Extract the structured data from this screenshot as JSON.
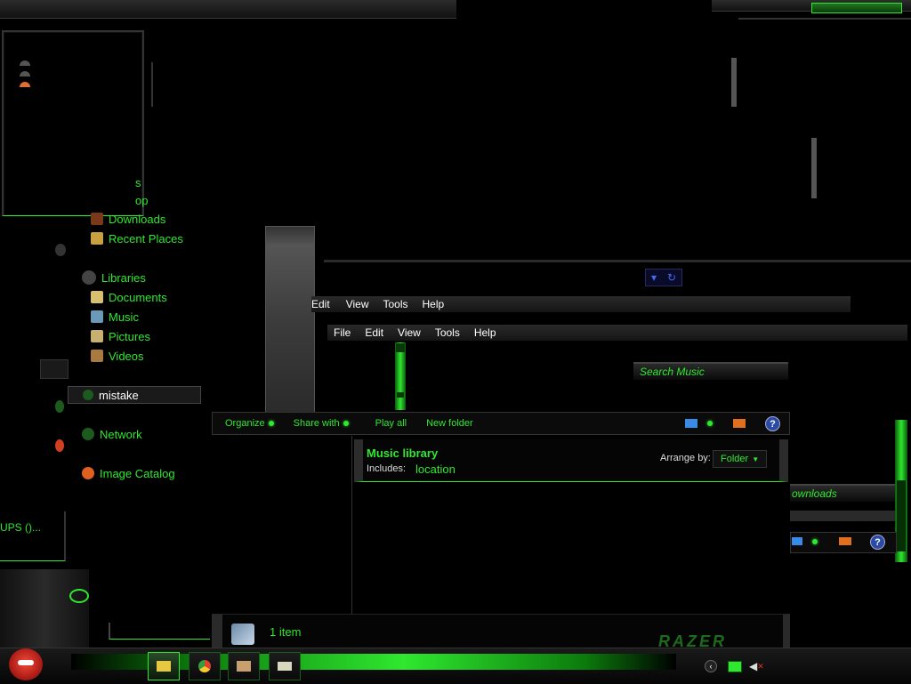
{
  "nav": {
    "partial_top": [
      "s",
      "op"
    ],
    "favorites": [
      {
        "label": "Downloads",
        "icon": "downloads-folder-icon"
      },
      {
        "label": "Recent Places",
        "icon": "recent-places-icon"
      }
    ],
    "libraries_label": "Libraries",
    "libraries": [
      {
        "label": "Documents",
        "icon": "documents-icon"
      },
      {
        "label": "Music",
        "icon": "music-icon"
      },
      {
        "label": "Pictures",
        "icon": "pictures-icon"
      },
      {
        "label": "Videos",
        "icon": "videos-icon"
      }
    ],
    "homegroup_label": "mistake",
    "network_label": "Network",
    "image_catalog_label": "Image Catalog"
  },
  "menubar_back": [
    "Edit",
    "View",
    "Tools",
    "Help"
  ],
  "menubar": [
    "File",
    "Edit",
    "View",
    "Tools",
    "Help"
  ],
  "search_placeholder": "Search Music",
  "command_bar": {
    "organize": "Organize",
    "share_with": "Share with",
    "play_all": "Play all",
    "new_folder": "New folder"
  },
  "library_header": {
    "title": "Music library",
    "includes_label": "Includes:",
    "includes_value": "location",
    "arrange_label": "Arrange by:",
    "arrange_value": "Folder"
  },
  "status_bar": {
    "items": "1 item"
  },
  "right_window": {
    "partial_label": "ownloads"
  },
  "left_fragment": "UPS ()...",
  "brand": "Razer",
  "colors": {
    "accent": "#2fe82f",
    "background": "#000000"
  }
}
